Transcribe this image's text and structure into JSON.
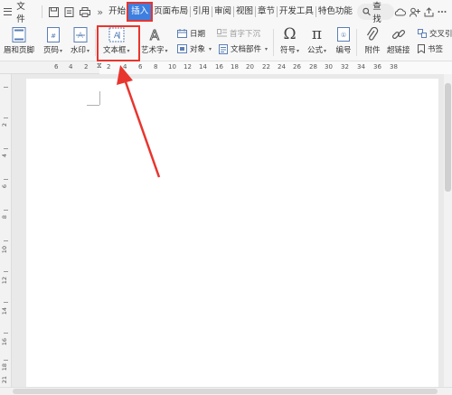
{
  "menu": {
    "file_label": "文件",
    "more_glyph": "»",
    "tabs": [
      {
        "label": "开始",
        "active": false
      },
      {
        "label": "插入",
        "active": true
      },
      {
        "label": "页面布局",
        "active": false
      },
      {
        "label": "引用",
        "active": false
      },
      {
        "label": "审阅",
        "active": false
      },
      {
        "label": "视图",
        "active": false
      },
      {
        "label": "章节",
        "active": false
      },
      {
        "label": "开发工具",
        "active": false
      },
      {
        "label": "特色功能",
        "active": false
      }
    ],
    "search_label": "查找"
  },
  "ribbon": {
    "header_footer": "眉和页脚",
    "page_number": "页码",
    "watermark": "水印",
    "textbox": "文本框",
    "wordart": "艺术字",
    "date": "日期",
    "dropcap": "首字下沉",
    "object": "对象",
    "doc_parts": "文档部件",
    "symbol": "符号",
    "symbol_glyph": "Ω",
    "formula": "公式",
    "formula_glyph": "π",
    "numbering": "编号",
    "attachment": "附件",
    "hyperlink": "超链接",
    "crossref": "交叉引",
    "bookmark": "书签",
    "caret": "▾"
  },
  "ruler": {
    "h_numbers": [
      "6",
      "4",
      "2",
      "2",
      "4",
      "6",
      "8",
      "10",
      "12",
      "14",
      "16",
      "18",
      "20",
      "22",
      "24",
      "26",
      "28",
      "30",
      "32",
      "34",
      "36",
      "38"
    ],
    "v_numbers": [
      "2",
      "4",
      "6",
      "8",
      "10",
      "12",
      "14",
      "16",
      "18",
      "20",
      "21"
    ]
  },
  "colors": {
    "accent": "#3d7fe0",
    "highlight": "#e8352e"
  }
}
